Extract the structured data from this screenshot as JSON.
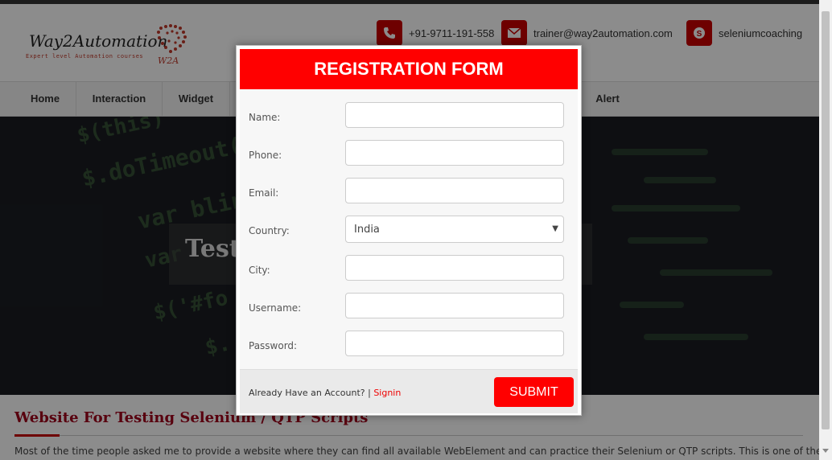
{
  "brand": {
    "name": "Way2Automation",
    "tagline": "Expert level Automation courses",
    "mark": "W2A"
  },
  "contacts": [
    {
      "icon": "phone-icon",
      "text": "+91-9711-191-558"
    },
    {
      "icon": "envelope-icon",
      "text": "trainer@way2automation.com"
    },
    {
      "icon": "skype-icon",
      "text": "seleniumcoaching"
    }
  ],
  "nav": {
    "items": [
      "Home",
      "Interaction",
      "Widget",
      "Alert"
    ]
  },
  "hero": {
    "title": "Test",
    "code_lines": [
      "$(this)",
      "$.doTimeout(",
      "var blin",
      "var",
      "$('#fo",
      "$."
    ]
  },
  "content": {
    "title": "Website For Testing Selenium / QTP Scripts",
    "text": "Most of the time people asked me to provide a website where they can find all available WebElement and can practice their Selenium or QTP scripts. This is one of the"
  },
  "modal": {
    "title": "REGISTRATION FORM",
    "fields": {
      "name_label": "Name:",
      "phone_label": "Phone:",
      "email_label": "Email:",
      "country_label": "Country:",
      "city_label": "City:",
      "username_label": "Username:",
      "password_label": "Password:"
    },
    "country_value": "India",
    "footer_text": "Already Have an Account? |",
    "signin_link": "Signin",
    "submit_label": "SUBMIT"
  },
  "colors": {
    "accent": "#ff0000",
    "brand_red": "#c80000",
    "heading_red": "#a0001a"
  }
}
